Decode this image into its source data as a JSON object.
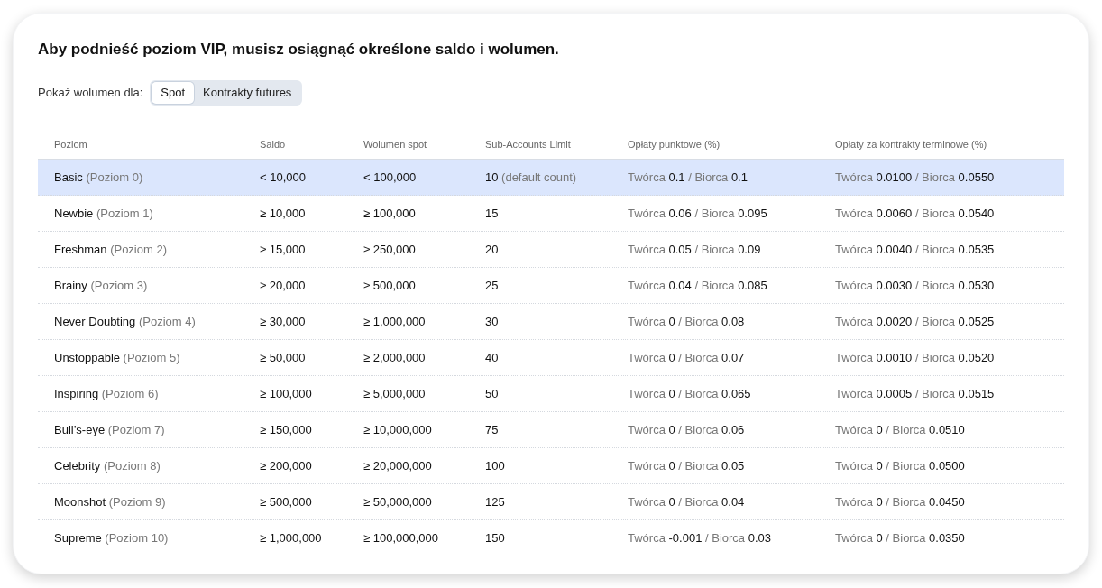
{
  "title": "Aby podnieść poziom VIP, musisz osiągnąć określone saldo i wolumen.",
  "volume_toggle": {
    "label": "Pokaż wolumen dla:",
    "tabs": [
      {
        "label": "Spot",
        "selected": true
      },
      {
        "label": "Kontrakty futures",
        "selected": false
      }
    ]
  },
  "table": {
    "columns": [
      "Poziom",
      "Saldo",
      "Wolumen spot",
      "Sub-Accounts Limit",
      "Opłaty punktowe (%)",
      "Opłaty za kontrakty terminowe (%)"
    ],
    "rows": [
      {
        "selected": true,
        "cells": [
          "**Basic** (Poziom 0)",
          "< 10,000",
          "< 100,000",
          "**10** (default count)",
          "Twórca **0.1** / Biorca **0.1**",
          "Twórca **0.0100** / Biorca **0.0550**"
        ]
      },
      {
        "selected": false,
        "cells": [
          "**Newbie** (Poziom 1)",
          "≥ 10,000",
          "≥ 100,000",
          "**15**",
          "Twórca **0.06** / Biorca **0.095**",
          "Twórca **0.0060** / Biorca **0.0540**"
        ]
      },
      {
        "selected": false,
        "cells": [
          "**Freshman** (Poziom 2)",
          "≥ 15,000",
          "≥ 250,000",
          "**20**",
          "Twórca **0.05** / Biorca **0.09**",
          "Twórca **0.0040** / Biorca **0.0535**"
        ]
      },
      {
        "selected": false,
        "cells": [
          "**Brainy** (Poziom 3)",
          "≥ 20,000",
          "≥ 500,000",
          "**25**",
          "Twórca **0.04** / Biorca **0.085**",
          "Twórca **0.0030** / Biorca **0.0530**"
        ]
      },
      {
        "selected": false,
        "cells": [
          "**Never Doubting** (Poziom 4)",
          "≥ 30,000",
          "≥ 1,000,000",
          "**30**",
          "Twórca **0** / Biorca **0.08**",
          "Twórca **0.0020** / Biorca **0.0525**"
        ]
      },
      {
        "selected": false,
        "cells": [
          "**Unstoppable** (Poziom 5)",
          "≥ 50,000",
          "≥ 2,000,000",
          "**40**",
          "Twórca **0** / Biorca **0.07**",
          "Twórca **0.0010** / Biorca **0.0520**"
        ]
      },
      {
        "selected": false,
        "cells": [
          "**Inspiring** (Poziom 6)",
          "≥ 100,000",
          "≥ 5,000,000",
          "**50**",
          "Twórca **0** / Biorca **0.065**",
          "Twórca **0.0005** / Biorca **0.0515**"
        ]
      },
      {
        "selected": false,
        "cells": [
          "**Bull’s-eye** (Poziom 7)",
          "≥ 150,000",
          "≥ 10,000,000",
          "**75**",
          "Twórca **0** / Biorca **0.06**",
          "Twórca **0** / Biorca **0.0510**"
        ]
      },
      {
        "selected": false,
        "cells": [
          "**Celebrity** (Poziom 8)",
          "≥ 200,000",
          "≥ 20,000,000",
          "**100**",
          "Twórca **0** / Biorca **0.05**",
          "Twórca **0** / Biorca **0.0500**"
        ]
      },
      {
        "selected": false,
        "cells": [
          "**Moonshot** (Poziom 9)",
          "≥ 500,000",
          "≥ 50,000,000",
          "**125**",
          "Twórca **0** / Biorca **0.04**",
          "Twórca **0** / Biorca **0.0450**"
        ]
      },
      {
        "selected": false,
        "cells": [
          "**Supreme** (Poziom 10)",
          "≥ 1,000,000",
          "≥ 100,000,000",
          "**150**",
          "Twórca **-0.001** / Biorca **0.03**",
          "Twórca **0** / Biorca **0.0350**"
        ]
      }
    ]
  }
}
